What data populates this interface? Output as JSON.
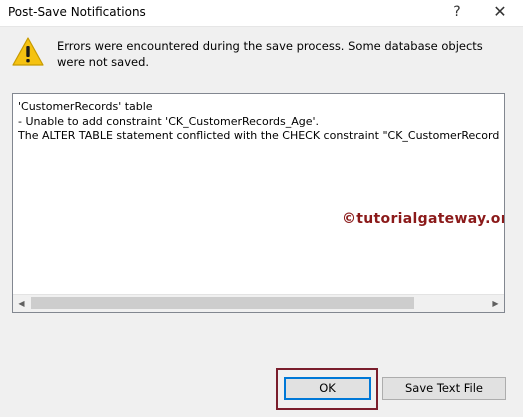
{
  "window": {
    "title": "Post-Save Notifications",
    "help_label": "?",
    "close_label": "✕"
  },
  "icons": {
    "warning": "warning-icon",
    "warning_color": "#f5c211"
  },
  "message": "Errors were encountered during the save process. Some database objects were not saved.",
  "details": {
    "lines": [
      "'CustomerRecords' table",
      "- Unable to add constraint 'CK_CustomerRecords_Age'.",
      "The ALTER TABLE statement conflicted with the CHECK constraint \"CK_CustomerRecords_"
    ]
  },
  "watermark": "©tutorialgateway.org",
  "buttons": {
    "ok_label": "OK",
    "save_label": "Save Text File"
  },
  "colors": {
    "highlight": "#7a1e2c",
    "watermark": "#8b1a1a",
    "default_button_border": "#0078d7"
  }
}
